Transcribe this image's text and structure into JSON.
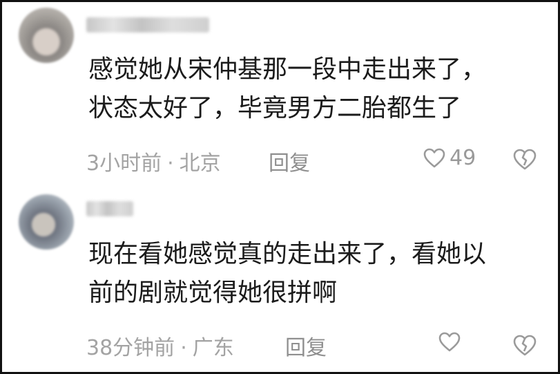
{
  "comments": [
    {
      "line1": "感觉她从宋仲基那一段中走出来了，",
      "line2": "状态太好了，毕竟男方二胎都生了",
      "time": "3小时前",
      "location": "北京",
      "reply": "回复",
      "likes": "49"
    },
    {
      "line1": "现在看她感觉真的走出来了，看她以",
      "line2": "前的剧就觉得她很拼啊",
      "time": "38分钟前",
      "location": "广东",
      "reply": "回复"
    }
  ],
  "separator": "·",
  "icons": {
    "like": "heart-outline-icon",
    "dislike": "broken-heart-icon"
  },
  "colors": {
    "text": "#1b1b1b",
    "meta": "#a3a3a3",
    "border": "#111111"
  }
}
